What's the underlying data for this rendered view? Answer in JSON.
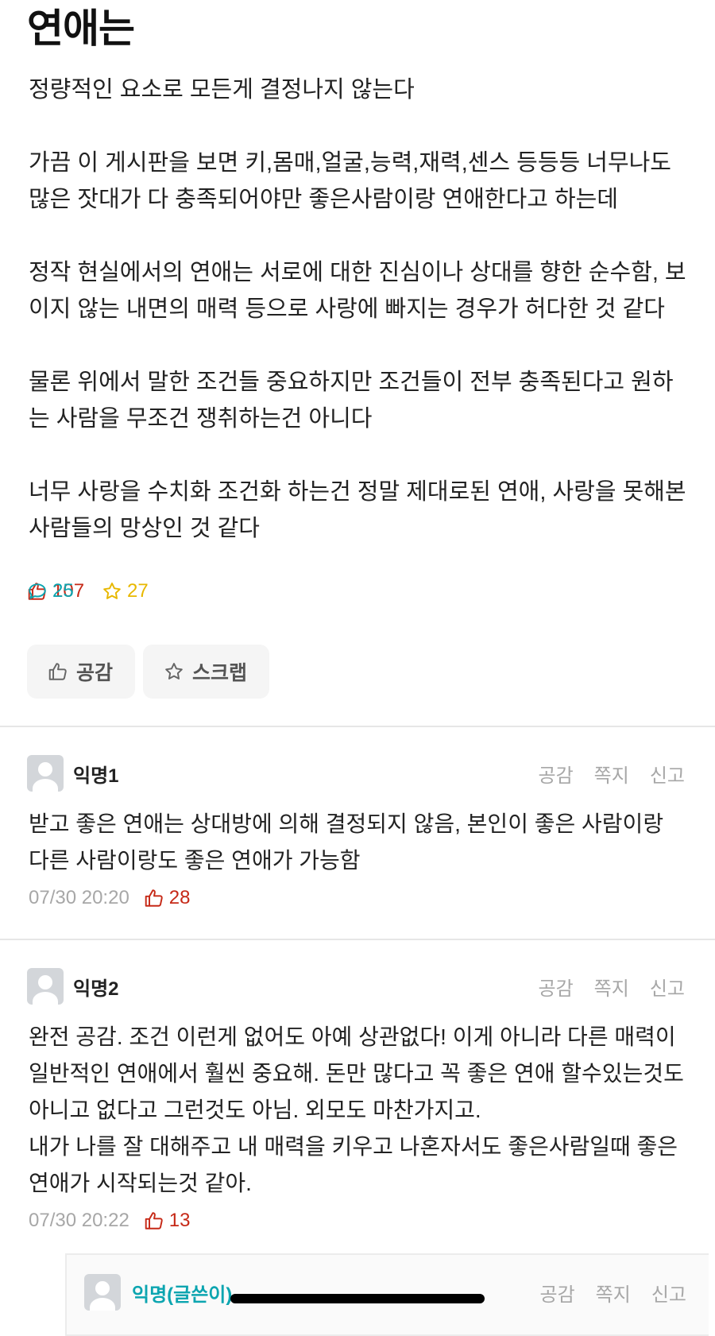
{
  "post": {
    "title": "연애는",
    "paragraphs": [
      "정량적인 요소로 모든게 결정나지 않는다",
      "가끔 이 게시판을 보면 키,몸매,얼굴,능력,재력,센스 등등등 너무나도 많은 잣대가 다 충족되어야만 좋은사람이랑 연애한다고 하는데",
      "정작 현실에서의 연애는 서로에 대한 진심이나 상대를 향한 순수함, 보이지 않는 내면의 매력 등으로 사랑에 빠지는 경우가 허다한 것 같다",
      "물론 위에서 말한 조건들 중요하지만 조건들이 전부 충족된다고 원하는 사람을 무조건 쟁취하는건 아니다",
      "너무 사랑을 수치화 조건화 하는건 정말 제대로된 연애, 사랑을 못해본 사람들의 망상인 것 같다"
    ],
    "like_count": "107",
    "comment_count": "25",
    "scrap_count": "27",
    "like_button_label": "공감",
    "scrap_button_label": "스크랩"
  },
  "comment_options": {
    "like": "공감",
    "message": "쪽지",
    "report": "신고"
  },
  "comments": [
    {
      "name": "익명1",
      "text": "받고 좋은 연애는 상대방에 의해 결정되지 않음, 본인이 좋은 사람이랑 다른 사람이랑도 좋은 연애가 가능함",
      "time": "07/30 20:20",
      "likes": "28"
    },
    {
      "name": "익명2",
      "text": "완전 공감. 조건 이런게 없어도 아예 상관없다! 이게 아니라 다른 매력이 일반적인 연애에서 훨씬 중요해. 돈만 많다고 꼭 좋은 연애 할수있는것도 아니고 없다고 그런것도 아님. 외모도 마찬가지고.\n내가 나를 잘 대해주고 내 매력을 키우고 나혼자서도 좋은사람일때 좋은 연애가 시작되는것 같아.",
      "time": "07/30 20:22",
      "likes": "13"
    }
  ],
  "reply": {
    "name": "익명(글쓴이)"
  },
  "colors": {
    "like": "#c62917",
    "comment": "#0ca5b0",
    "scrap": "#e8b800",
    "muted": "#a7a7a7"
  }
}
